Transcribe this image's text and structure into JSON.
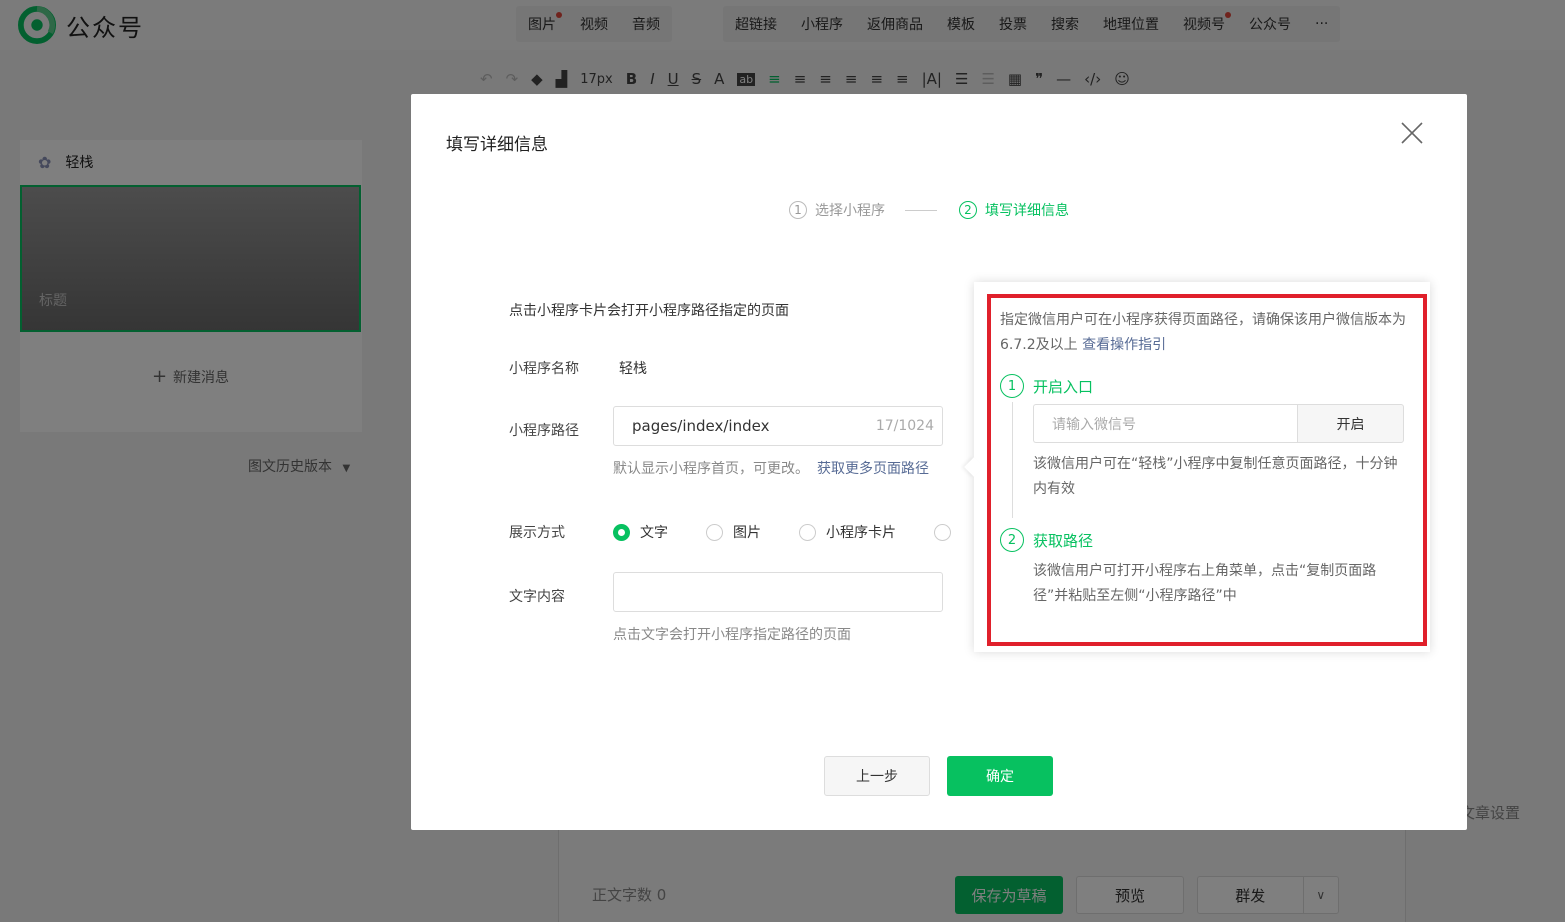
{
  "app": {
    "title": "公众号"
  },
  "top_menu": {
    "group1": [
      {
        "label": "图片",
        "dot": true
      },
      {
        "label": "视频",
        "dot": false
      },
      {
        "label": "音频",
        "dot": false
      }
    ],
    "group2": [
      {
        "label": "超链接",
        "dot": false
      },
      {
        "label": "小程序",
        "dot": false
      },
      {
        "label": "返佣商品",
        "dot": false
      },
      {
        "label": "模板",
        "dot": false
      },
      {
        "label": "投票",
        "dot": false
      },
      {
        "label": "搜索",
        "dot": false
      },
      {
        "label": "地理位置",
        "dot": false
      },
      {
        "label": "视频号",
        "dot": true
      },
      {
        "label": "公众号",
        "dot": false
      },
      {
        "label": "···",
        "dot": false
      }
    ]
  },
  "toolbar": {
    "font_size": "17px"
  },
  "left_panel": {
    "account_name": "轻栈",
    "card_title": "标题",
    "new_message": "新建消息",
    "history": "图文历史版本"
  },
  "editor_footer": {
    "word_count": "正文字数  0",
    "save_draft": "保存为草稿",
    "preview": "预览",
    "publish": "群发",
    "article_settings": "文章设置"
  },
  "modal": {
    "title": "填写详细信息",
    "steps": [
      {
        "num": "1",
        "label": "选择小程序"
      },
      {
        "num": "2",
        "label": "填写详细信息"
      }
    ],
    "description": "点击小程序卡片会打开小程序路径指定的页面",
    "name_label": "小程序名称",
    "name_value": "轻栈",
    "path_label": "小程序路径",
    "path_value": "pages/index/index",
    "path_count": "17/1024",
    "path_hint": "默认显示小程序首页，可更改。",
    "path_link": "获取更多页面路径",
    "display_label": "展示方式",
    "display_options": [
      "文字",
      "图片",
      "小程序卡片"
    ],
    "display_selected": "文字",
    "text_label": "文字内容",
    "text_value": "",
    "text_hint": "点击文字会打开小程序指定路径的页面",
    "prev_button": "上一步",
    "confirm_button": "确定"
  },
  "popover": {
    "intro": "指定微信用户可在小程序获得页面路径，请确保该用户微信版本为6.7.2及以上",
    "intro_link": "查看操作指引",
    "step1_num": "1",
    "step1_title": "开启入口",
    "wechat_placeholder": "请输入微信号",
    "open_button": "开启",
    "step1_text": "该微信用户可在“轻栈”小程序中复制任意页面路径，十分钟内有效",
    "step2_num": "2",
    "step2_title": "获取路径",
    "step2_text": "该微信用户可打开小程序右上角菜单，点击“复制页面路径”并粘贴至左侧“小程序路径”中"
  },
  "colors": {
    "brand": "#07c160",
    "link": "#576b95",
    "highlight": "#e0202b"
  }
}
